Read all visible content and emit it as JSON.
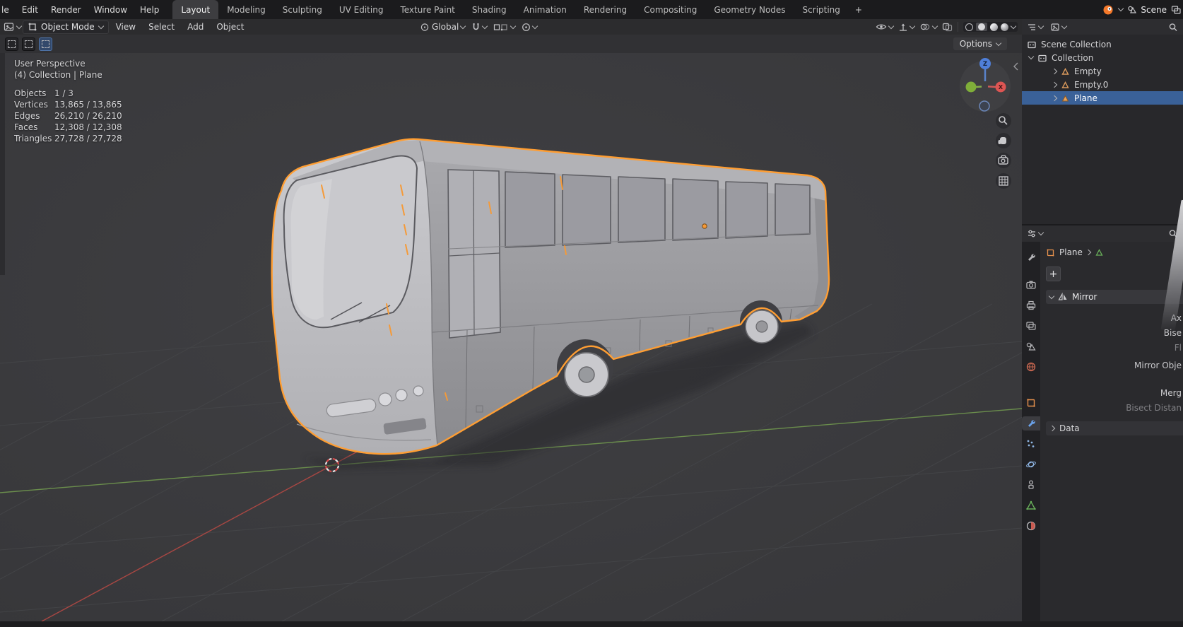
{
  "icons": {
    "plus": "+"
  },
  "topbar": {
    "menus": [
      {
        "label": "le"
      },
      {
        "label": "Edit"
      },
      {
        "label": "Render"
      },
      {
        "label": "Window"
      },
      {
        "label": "Help"
      }
    ],
    "tabs": [
      {
        "label": "Layout",
        "active": true
      },
      {
        "label": "Modeling"
      },
      {
        "label": "Sculpting"
      },
      {
        "label": "UV Editing"
      },
      {
        "label": "Texture Paint"
      },
      {
        "label": "Shading"
      },
      {
        "label": "Animation"
      },
      {
        "label": "Rendering"
      },
      {
        "label": "Compositing"
      },
      {
        "label": "Geometry Nodes"
      },
      {
        "label": "Scripting"
      }
    ],
    "add_tab": "+",
    "scene_name": "Scene"
  },
  "header": {
    "mode": "Object Mode",
    "menus": [
      {
        "label": "View"
      },
      {
        "label": "Select"
      },
      {
        "label": "Add"
      },
      {
        "label": "Object"
      }
    ],
    "orientation": "Global"
  },
  "tool_settings": {
    "options": "Options"
  },
  "viewport": {
    "perspective_label": "User Perspective",
    "context_label": "(4) Collection | Plane",
    "stats": [
      {
        "label": "Objects",
        "value": "1 / 3"
      },
      {
        "label": "Vertices",
        "value": "13,865 / 13,865"
      },
      {
        "label": "Edges",
        "value": "26,210 / 26,210"
      },
      {
        "label": "Faces",
        "value": "12,308 / 12,308"
      },
      {
        "label": "Triangles",
        "value": "27,728 / 27,728"
      }
    ],
    "gizmo": {
      "z_label": "Z",
      "x_label": "X"
    }
  },
  "outliner": {
    "scene_collection": "Scene Collection",
    "collection": "Collection",
    "items": [
      {
        "label": "Empty",
        "selected": false
      },
      {
        "label": "Empty.0",
        "selected": false
      },
      {
        "label": "Plane",
        "selected": true
      }
    ]
  },
  "properties": {
    "breadcrumb_object": "Plane",
    "modifier": {
      "name": "Mirror",
      "labels": [
        {
          "text": "Ax",
          "muted": false
        },
        {
          "text": "Bise",
          "muted": false
        },
        {
          "text": "Fl",
          "muted": true
        },
        {
          "text": "Mirror Obje",
          "muted": false
        },
        {
          "text": "Merg",
          "muted": false
        },
        {
          "text": "Bisect Distan",
          "muted": true
        }
      ],
      "subpanel": "Data"
    },
    "tab_icons": [
      "tool",
      "render",
      "output",
      "view-layer",
      "scene",
      "world",
      "object",
      "modifiers",
      "particles",
      "physics",
      "constraints",
      "object-data",
      "material"
    ]
  }
}
